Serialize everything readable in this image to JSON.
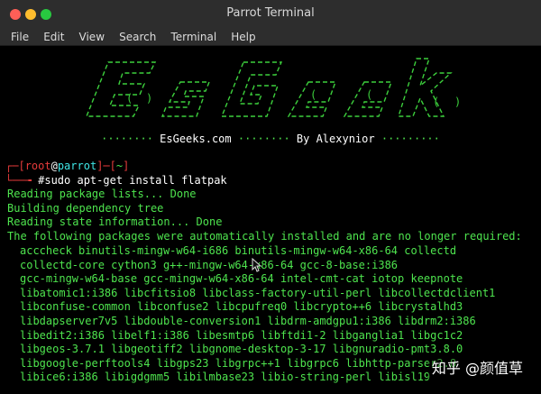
{
  "window": {
    "title": "Parrot Terminal"
  },
  "menu": [
    "File",
    "Edit",
    "View",
    "Search",
    "Terminal",
    "Help"
  ],
  "banner": {
    "credit_dots_left": "········",
    "credit_site": "EsGeeks.com",
    "credit_dots_mid": "········",
    "credit_author": "By Alexynior",
    "credit_dots_right": "·········"
  },
  "prompt": {
    "user": "root",
    "at": "@",
    "host": "parrot",
    "dir": "~",
    "hash": "#",
    "command": "sudo apt-get install flatpak"
  },
  "output": [
    "Reading package lists... Done",
    "Building dependency tree",
    "Reading state information... Done",
    "The following packages were automatically installed and are no longer required:"
  ],
  "packages": [
    "acccheck binutils-mingw-w64-i686 binutils-mingw-w64-x86-64 collectd",
    "collectd-core cython3 g++-mingw-w64-x86-64 gcc-8-base:i386",
    "gcc-mingw-w64-base gcc-mingw-w64-x86-64 intel-cmt-cat iotop keepnote",
    "libatomic1:i386 libcfitsio8 libclass-factory-util-perl libcollectdclient1",
    "libconfuse-common libconfuse2 libcpufreq0 libcrypto++6 libcrystalhd3",
    "libdapserver7v5 libdouble-conversion1 libdrm-amdgpu1:i386 libdrm2:i386",
    "libedit2:i386 libelf1:i386 libesmtp6 libftdi1-2 libganglia1 libgc1c2",
    "libgeos-3.7.1 libgeotiff2 libgnome-desktop-3-17 libgnuradio-pmt3.8.0",
    "libgoogle-perftools4 libgps23 libgrpc++1 libgrpc6 libhttp-parser2.8",
    "libice6:i386 libigdgmm5 libilmbase23 libio-string-perl libisl19"
  ],
  "watermark": "知乎 @颜值草",
  "colors": {
    "terminal_green": "#4ee44e",
    "prompt_red": "#e63b3b",
    "prompt_cyan": "#3fe6e6",
    "titlebar": "#2d2d2d"
  }
}
